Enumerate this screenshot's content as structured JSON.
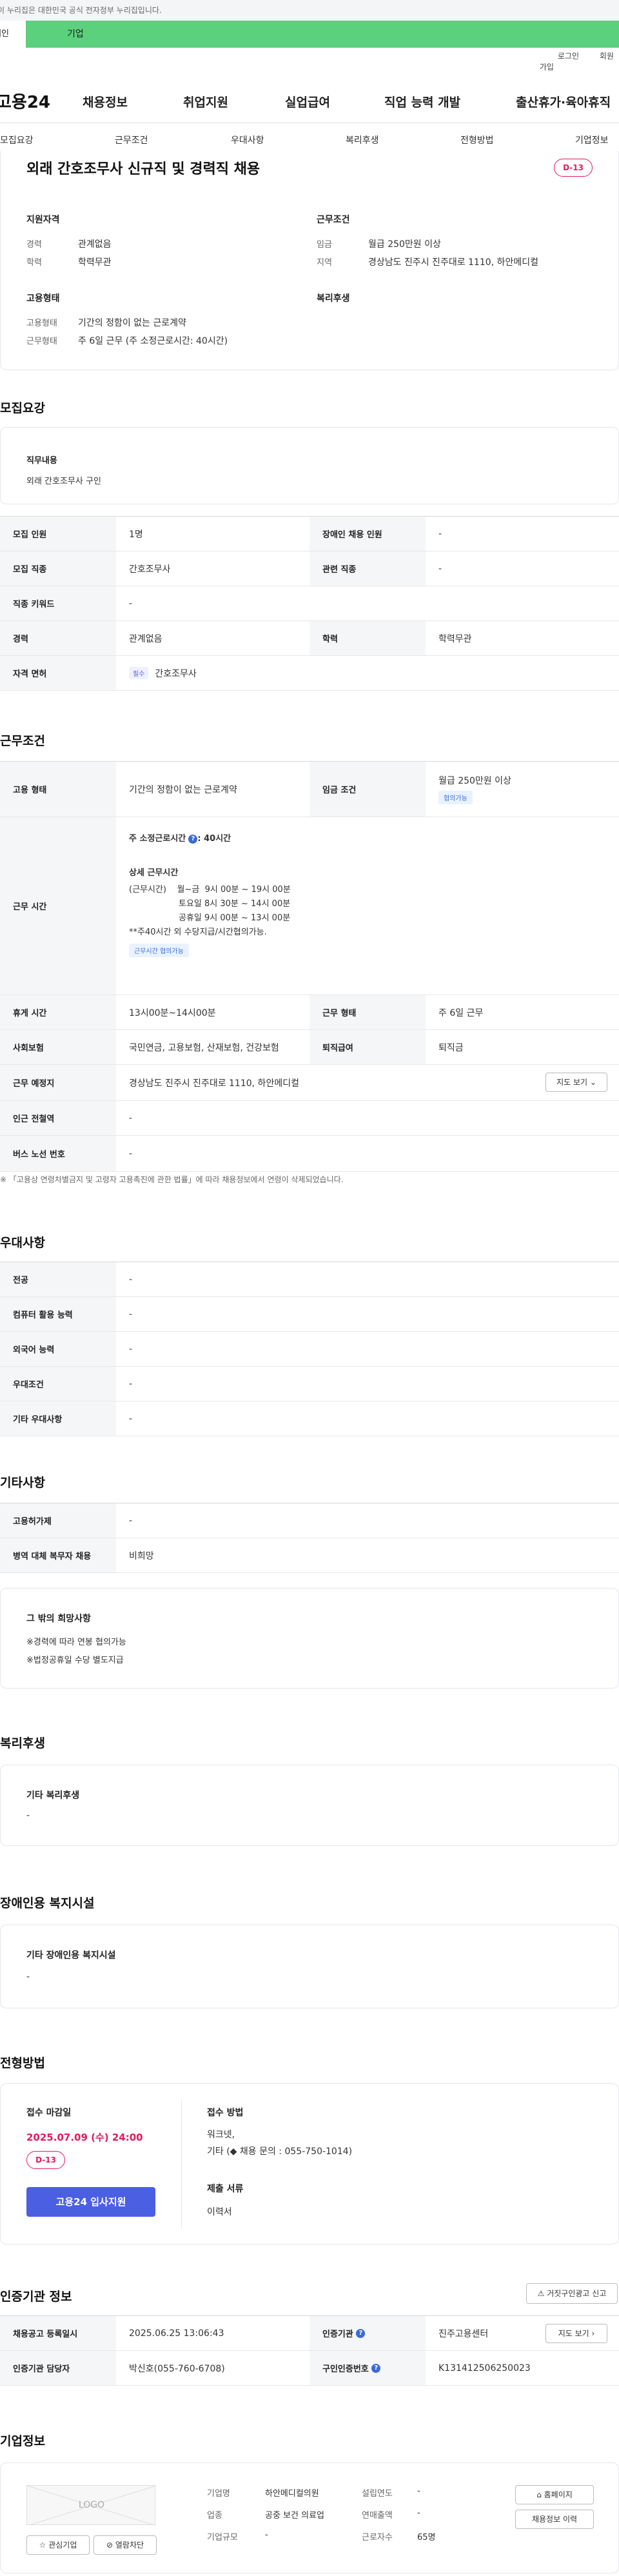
{
  "topbar": {
    "notice": "이 누리집은 대한민국 공식 전자정부 누리집입니다."
  },
  "member_tabs": {
    "personal": "개인",
    "company": "기업"
  },
  "util": {
    "login": "로그인",
    "join": "회원가입"
  },
  "gnb": {
    "logo": "고용24",
    "items": [
      "채용정보",
      "취업지원",
      "실업급여",
      "직업 능력 개발",
      "출산휴가·육아휴직"
    ]
  },
  "lnb": {
    "items": [
      "모집요강",
      "근무조건",
      "우대사항",
      "복리후생",
      "전형방법",
      "기업정보"
    ]
  },
  "summary": {
    "title": "외래 간호조무사 신규직 및 경력직 채용",
    "dday": "D-13",
    "qual_title": "지원자격",
    "qual": [
      {
        "k": "경력",
        "v": "관계없음"
      },
      {
        "k": "학력",
        "v": "학력무관"
      }
    ],
    "cond_title": "근무조건",
    "cond": [
      {
        "k": "임금",
        "v": "월급 250만원 이상"
      },
      {
        "k": "지역",
        "v": "경상남도 진주시 진주대로 1110, 하안메디컬"
      }
    ],
    "emp_title": "고용형태",
    "emp": [
      {
        "k": "고용형태",
        "v": "기간의 정함이 없는 근로계약"
      },
      {
        "k": "근무형태",
        "v": "주 6일 근무 (주 소정근로시간: 40시간)"
      }
    ],
    "welfare_title": "복리후생"
  },
  "recruit": {
    "section": "모집요강",
    "duty_title": "직무내용",
    "duty": "외래 간호조무사 구인",
    "rows": [
      {
        "k1": "모집 인원",
        "v1": "1명",
        "k2": "장애인 채용 인원",
        "v2": "-"
      },
      {
        "k1": "모집 직종",
        "v1": "간호조무사",
        "k2": "관련 직종",
        "v2": "-"
      },
      {
        "k1": "직종 키워드",
        "v1": "-"
      },
      {
        "k1": "경력",
        "v1": "관계없음",
        "k2": "학력",
        "v2": "학력무관"
      },
      {
        "k1": "자격 면허",
        "badge": "필수",
        "v1": "간호조무사"
      }
    ]
  },
  "work": {
    "section": "근무조건",
    "emp_k": "고용 형태",
    "emp_v": "기간의 정함이 없는 근로계약",
    "wage_k": "임금 조건",
    "wage_v": "월급 250만원 이상",
    "wage_badge": "협의가능",
    "time_k": "근무 시간",
    "time_main_prefix": "주 소정근로시간",
    "time_main_value": ": 40시간",
    "time_detail_title": "상세 근무시간",
    "time_lines": [
      "(근무시간)    월~금  9시 00분 ~ 19시 00분",
      "토요일  8시 30분 ~ 14시 00분",
      "공휴일  9시 00분 ~ 13시 00분",
      "**주40시간 외 수당지급/시간협의가능."
    ],
    "time_badge": "근무시간 협의가능",
    "rest_k": "휴게 시간",
    "rest_v": "13시00분~14시00분",
    "type_k": "근무 형태",
    "type_v": "주 6일 근무",
    "ins_k": "사회보험",
    "ins_v": "국민연금, 고용보험, 산재보험, 건강보험",
    "retire_k": "퇴직급여",
    "retire_v": "퇴직금",
    "place_k": "근무 예정지",
    "place_v": "경상남도 진주시 진주대로 1110, 하안메디컬",
    "map_btn": "지도 보기",
    "subway_k": "인근 전철역",
    "subway_v": "-",
    "bus_k": "버스 노선 번호",
    "bus_v": "-",
    "note": "※ 「고용상 연령차별금지 및 고령자 고용촉진에 관한 법률」에 따라 채용정보에서 연령이 삭제되었습니다."
  },
  "pref": {
    "section": "우대사항",
    "rows": [
      {
        "k": "전공",
        "v": "-"
      },
      {
        "k": "컴퓨터 활용 능력",
        "v": "-"
      },
      {
        "k": "외국어 능력",
        "v": "-"
      },
      {
        "k": "우대조건",
        "v": "-"
      },
      {
        "k": "기타 우대사항",
        "v": "-"
      }
    ]
  },
  "etc": {
    "section": "기타사항",
    "rows": [
      {
        "k": "고용허가제",
        "v": "-"
      },
      {
        "k": "병역 대체 복무자 채용",
        "v": "비희망"
      }
    ],
    "box_title": "그 밖의 희망사항",
    "box_lines": [
      "※경력에 따라 연봉 협의가능",
      "※법정공휴일 수당 별도지급"
    ]
  },
  "welfare": {
    "section": "복리후생",
    "box_title": "기타 복리후생",
    "box_v": "-"
  },
  "disabled": {
    "section": "장애인용 복지시설",
    "box_title": "기타 장애인용 복지시설",
    "box_v": "-"
  },
  "process": {
    "section": "전형방법",
    "deadline_title": "접수 마감일",
    "deadline": "2025.07.09 (수) 24:00",
    "dday": "D-13",
    "apply_btn": "고용24 입사지원",
    "method_title": "접수 방법",
    "method_lines": [
      "워크넷,",
      "기타 (◆ 채용 문의 : 055-750-1014)"
    ],
    "docs_title": "제출 서류",
    "docs_v": "이력서"
  },
  "agency": {
    "section": "인증기관 정보",
    "report_btn": "거짓구인광고 신고",
    "reg_k": "채용공고 등록일시",
    "reg_v": "2025.06.25 13:06:43",
    "org_k": "인증기관",
    "org_v": "진주고용센터",
    "map_btn": "지도 보기",
    "staff_k": "인증기관 담당자",
    "staff_v": "박신호(055-760-6708)",
    "num_k": "구인인증번호",
    "num_v": "K131412506250023"
  },
  "company": {
    "section": "기업정보",
    "logo_text": "LOGO",
    "fav_btn": "관심기업",
    "block_btn": "열람차단",
    "name_k": "기업명",
    "name_v": "하안메디컬의원",
    "ind_k": "업종",
    "ind_v": "공중 보건 의료업",
    "size_k": "기업규모",
    "size_v": "-",
    "year_k": "설립연도",
    "year_v": "-",
    "sales_k": "연매출액",
    "sales_v": "-",
    "emp_k": "근로자수",
    "emp_v": "65명",
    "home_btn": "홈페이지",
    "history_btn": "채용정보 이력"
  }
}
